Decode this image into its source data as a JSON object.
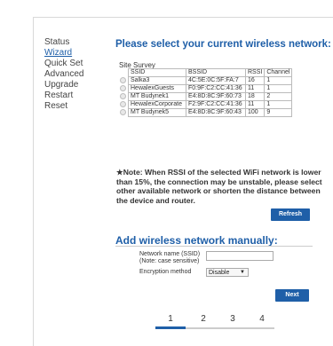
{
  "sidebar": {
    "items": [
      {
        "label": "Status"
      },
      {
        "label": "Wizard"
      },
      {
        "label": "Quick Set"
      },
      {
        "label": "Advanced"
      },
      {
        "label": "Upgrade"
      },
      {
        "label": "Restart"
      },
      {
        "label": "Reset"
      }
    ],
    "active_index": 1
  },
  "page": {
    "title": "Please select your current wireless network:",
    "site_survey_label": "Site Survey"
  },
  "survey_table": {
    "headers": [
      "SSID",
      "BSSID",
      "RSSI",
      "Channel"
    ],
    "rows": [
      {
        "ssid": "Salka3",
        "bssid": "4C:5E:0C:5F:FA:7",
        "rssi": "16",
        "channel": "1"
      },
      {
        "ssid": "HewalexGuests",
        "bssid": "F0:9F:C2:CC:41:36",
        "rssi": "11",
        "channel": "1"
      },
      {
        "ssid": "MT Budynek1",
        "bssid": "E4:8D:8C:9F:60:73",
        "rssi": "18",
        "channel": "2"
      },
      {
        "ssid": "HewalexCorporate",
        "bssid": "F2:9F:C2:CC:41:36",
        "rssi": "11",
        "channel": "1"
      },
      {
        "ssid": "MT Budynek5",
        "bssid": "E4:8D:8C:9F:60:43",
        "rssi": "100",
        "channel": "9"
      }
    ]
  },
  "note": "★Note: When RSSI of the selected WiFi network is lower than 15%, the connection may be unstable, please select other available network or shorten the distance between the device and router.",
  "refresh_label": "Refresh",
  "manual": {
    "title": "Add wireless network manually:",
    "ssid_label": "Network name (SSID)",
    "ssid_sublabel": "(Note: case sensitive)",
    "ssid_value": "",
    "encryption_label": "Encryption method",
    "encryption_selected": "Disable"
  },
  "next_label": "Next",
  "steps": {
    "items": [
      "1",
      "2",
      "3",
      "4"
    ],
    "active_index": 0
  },
  "colors": {
    "accent": "#1f5fa8"
  }
}
